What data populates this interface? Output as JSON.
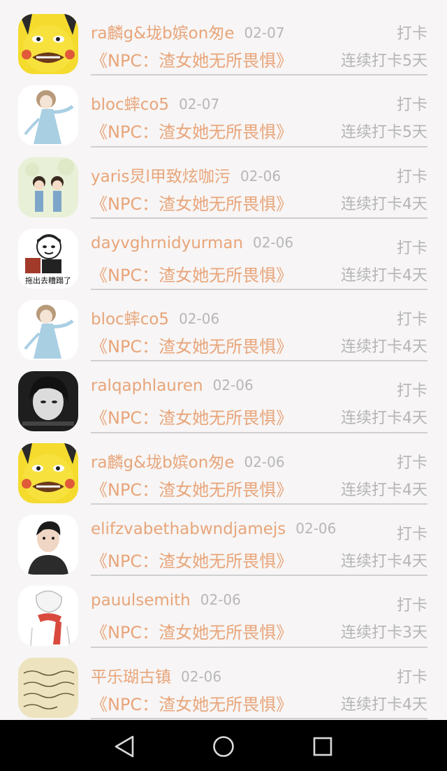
{
  "list": {
    "items": [
      {
        "name": "ra麟g&垅b嫔on匆e",
        "date": "02-07",
        "action": "打卡",
        "book": "《NPC：渣女她无所畏惧》",
        "streak": "连续打卡5天",
        "avatar": "pikachu-meme"
      },
      {
        "name": "bloc蟀co5",
        "date": "02-07",
        "action": "打卡",
        "book": "《NPC：渣女她无所畏惧》",
        "streak": "连续打卡5天",
        "avatar": "anime-girl-blue"
      },
      {
        "name": "yaris炅l甲致炫咖污",
        "date": "02-06",
        "action": "打卡",
        "book": "《NPC：渣女她无所畏惧》",
        "streak": "连续打卡4天",
        "avatar": "cartoon-couple"
      },
      {
        "name": "dayvghrnidyurman",
        "date": "02-06",
        "action": "打卡",
        "book": "《NPC：渣女她无所畏惧》",
        "streak": "连续打卡4天",
        "avatar": "meme-sticker",
        "avatar_caption": "拖出去糟蹋了"
      },
      {
        "name": "bloc蟀co5",
        "date": "02-06",
        "action": "打卡",
        "book": "《NPC：渣女她无所畏惧》",
        "streak": "连续打卡4天",
        "avatar": "anime-girl-blue"
      },
      {
        "name": "ralqaphlauren",
        "date": "02-06",
        "action": "打卡",
        "book": "《NPC：渣女她无所畏惧》",
        "streak": "连续打卡4天",
        "avatar": "bw-portrait"
      },
      {
        "name": "ra麟g&垅b嫔on匆e",
        "date": "02-06",
        "action": "打卡",
        "book": "《NPC：渣女她无所畏惧》",
        "streak": "连续打卡4天",
        "avatar": "pikachu-meme"
      },
      {
        "name": "elifzvabethabwndjamejs",
        "date": "02-06",
        "action": "打卡",
        "book": "《NPC：渣女她无所畏惧》",
        "streak": "连续打卡4天",
        "avatar": "man-portrait"
      },
      {
        "name": "pauulsemith",
        "date": "02-06",
        "action": "打卡",
        "book": "《NPC：渣女她无所畏惧》",
        "streak": "连续打卡3天",
        "avatar": "anime-scarf"
      },
      {
        "name": "平乐瑚古镇",
        "date": "02-06",
        "action": "打卡",
        "book": "《NPC：渣女她无所畏惧》",
        "streak": "连续打卡4天",
        "avatar": "handwriting-note"
      }
    ]
  },
  "navbar": {
    "back": "back-icon",
    "home": "home-icon",
    "recents": "recents-icon"
  },
  "colors": {
    "accent": "#e8a57a",
    "muted": "#b5b5b5",
    "background": "#f7f5f5",
    "navbar": "#000000"
  }
}
